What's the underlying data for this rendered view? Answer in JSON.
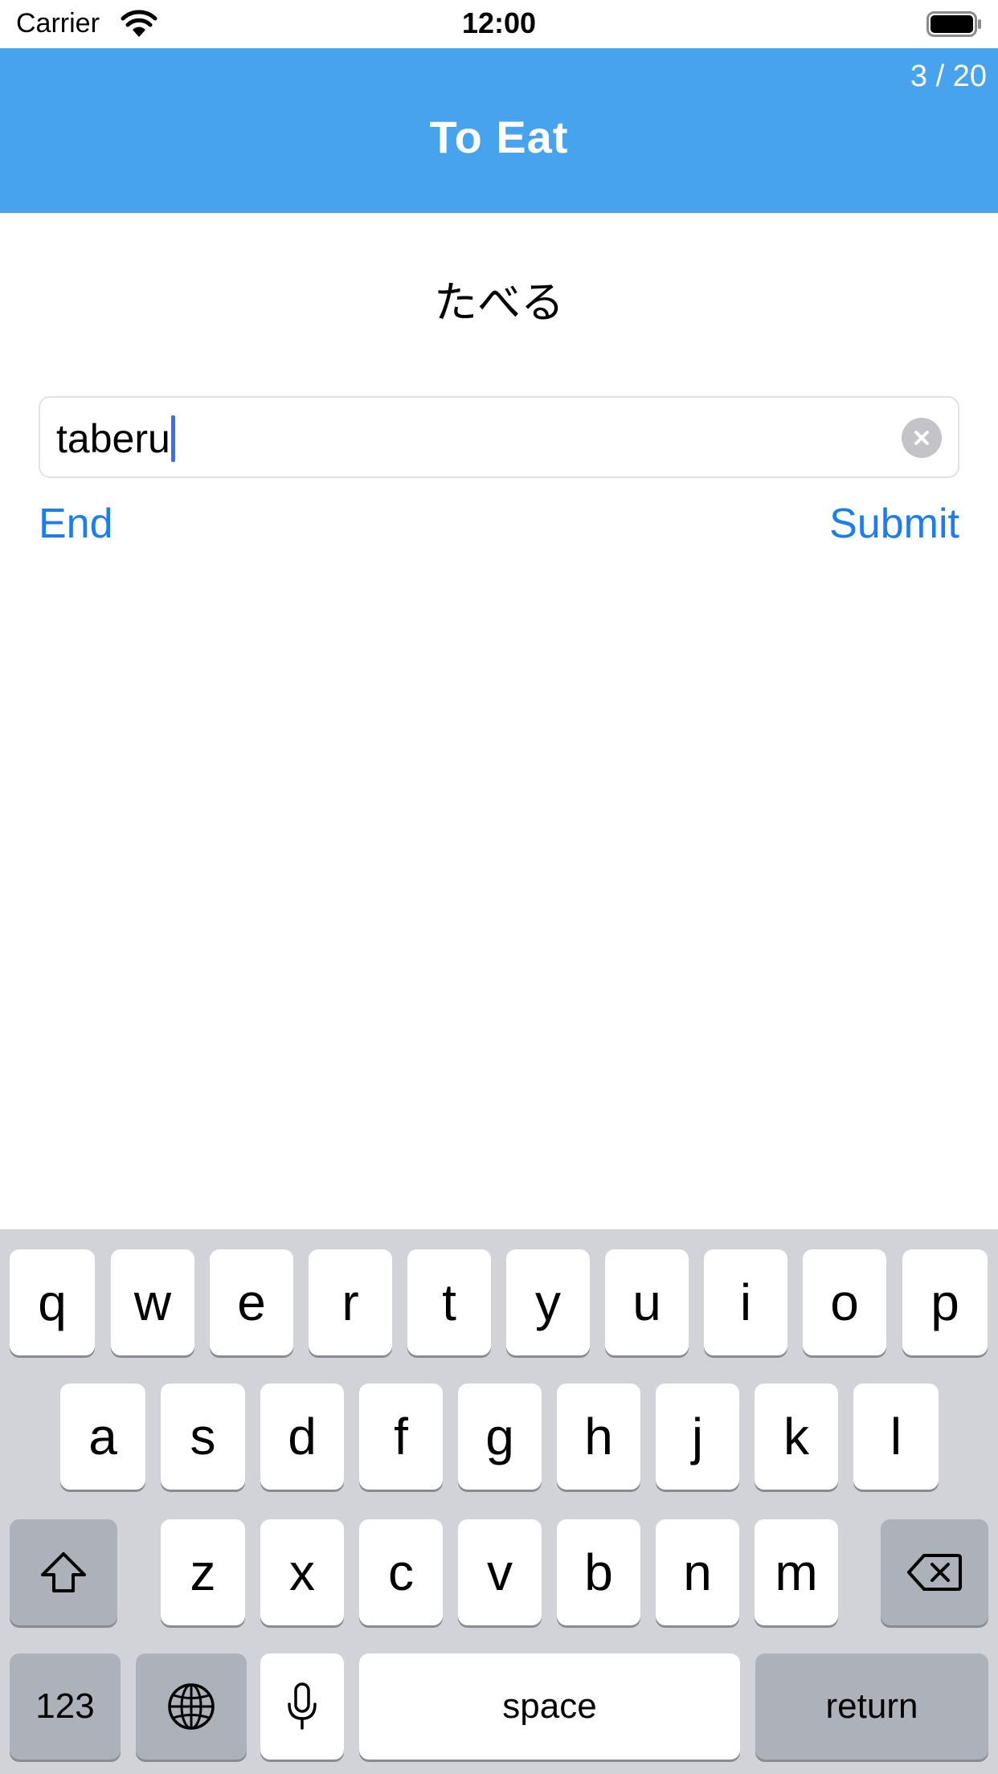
{
  "status_bar": {
    "carrier": "Carrier",
    "time": "12:00"
  },
  "header": {
    "title": "To Eat",
    "progress": "3 / 20"
  },
  "prompt": {
    "kana": "たべる"
  },
  "answer": {
    "value": "taberu"
  },
  "actions": {
    "end_label": "End",
    "submit_label": "Submit"
  },
  "keyboard": {
    "row1": [
      "q",
      "w",
      "e",
      "r",
      "t",
      "y",
      "u",
      "i",
      "o",
      "p"
    ],
    "row2": [
      "a",
      "s",
      "d",
      "f",
      "g",
      "h",
      "j",
      "k",
      "l"
    ],
    "row3": [
      "z",
      "x",
      "c",
      "v",
      "b",
      "n",
      "m"
    ],
    "numbers_label": "123",
    "space_label": "space",
    "return_label": "return"
  },
  "colors": {
    "header": "#48a3ef",
    "link": "#1c7cf2",
    "caret": "#3c6ee8",
    "keyboard_bg": "#d2d3d9",
    "key_special": "#acb1ba"
  },
  "icons": {
    "wifi": "wifi-icon",
    "battery": "battery-icon",
    "clear": "clear-icon",
    "shift": "shift-icon",
    "backspace": "backspace-icon",
    "globe": "globe-icon",
    "microphone": "microphone-icon"
  }
}
